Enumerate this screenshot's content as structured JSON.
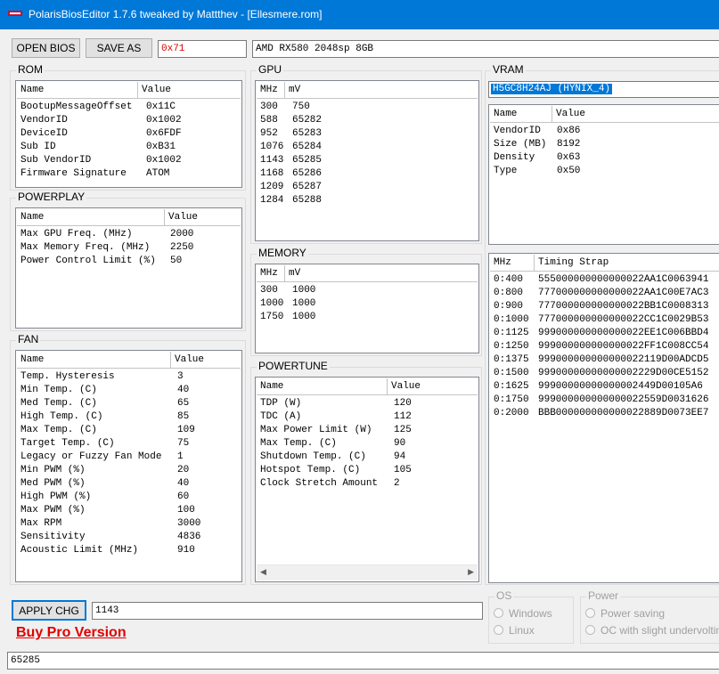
{
  "window": {
    "title": "PolarisBiosEditor 1.7.6 tweaked by Mattthev  - [Ellesmere.rom]",
    "titlebar_color": "#0078d7"
  },
  "toolbar": {
    "open_label": "OPEN BIOS",
    "save_label": "SAVE AS",
    "hex_value": "0x71",
    "gpu_name": "AMD RX580 2048sp 8GB"
  },
  "rom": {
    "label": "ROM",
    "col_name": "Name",
    "col_value": "Value",
    "rows": [
      {
        "name": "BootupMessageOffset",
        "value": "0x11C"
      },
      {
        "name": "VendorID",
        "value": "0x1002"
      },
      {
        "name": "DeviceID",
        "value": "0x6FDF"
      },
      {
        "name": "Sub ID",
        "value": "0xB31"
      },
      {
        "name": "Sub VendorID",
        "value": "0x1002"
      },
      {
        "name": "Firmware Signature",
        "value": "ATOM"
      }
    ]
  },
  "powerplay": {
    "label": "POWERPLAY",
    "col_name": "Name",
    "col_value": "Value",
    "rows": [
      {
        "name": "Max GPU Freq. (MHz)",
        "value": "2000"
      },
      {
        "name": "Max Memory Freq. (MHz)",
        "value": "2250"
      },
      {
        "name": "Power Control Limit (%)",
        "value": "50"
      }
    ]
  },
  "fan": {
    "label": "FAN",
    "col_name": "Name",
    "col_value": "Value",
    "rows": [
      {
        "name": "Temp. Hysteresis",
        "value": "3"
      },
      {
        "name": "Min Temp. (C)",
        "value": "40"
      },
      {
        "name": "Med Temp. (C)",
        "value": "65"
      },
      {
        "name": "High Temp. (C)",
        "value": "85"
      },
      {
        "name": "Max Temp. (C)",
        "value": "109"
      },
      {
        "name": "Target Temp. (C)",
        "value": "75"
      },
      {
        "name": "Legacy or Fuzzy Fan Mode",
        "value": "1"
      },
      {
        "name": "Min PWM (%)",
        "value": "20"
      },
      {
        "name": "Med PWM (%)",
        "value": "40"
      },
      {
        "name": "High PWM (%)",
        "value": "60"
      },
      {
        "name": "Max PWM (%)",
        "value": "100"
      },
      {
        "name": "Max RPM",
        "value": "3000"
      },
      {
        "name": "Sensitivity",
        "value": "4836"
      },
      {
        "name": "Acoustic Limit (MHz)",
        "value": "910"
      }
    ]
  },
  "gpu": {
    "label": "GPU",
    "col_mhz": "MHz",
    "col_mv": "mV",
    "rows": [
      {
        "mhz": "300",
        "mv": "750"
      },
      {
        "mhz": "588",
        "mv": "65282"
      },
      {
        "mhz": "952",
        "mv": "65283"
      },
      {
        "mhz": "1076",
        "mv": "65284"
      },
      {
        "mhz": "1143",
        "mv": "65285"
      },
      {
        "mhz": "1168",
        "mv": "65286"
      },
      {
        "mhz": "1209",
        "mv": "65287"
      },
      {
        "mhz": "1284",
        "mv": "65288"
      }
    ]
  },
  "memory": {
    "label": "MEMORY",
    "col_mhz": "MHz",
    "col_mv": "mV",
    "rows": [
      {
        "mhz": "300",
        "mv": "1000"
      },
      {
        "mhz": "1000",
        "mv": "1000"
      },
      {
        "mhz": "1750",
        "mv": "1000"
      }
    ]
  },
  "powertune": {
    "label": "POWERTUNE",
    "col_name": "Name",
    "col_value": "Value",
    "rows": [
      {
        "name": "TDP (W)",
        "value": "120"
      },
      {
        "name": "TDC (A)",
        "value": "112"
      },
      {
        "name": "Max Power Limit (W)",
        "value": "125"
      },
      {
        "name": "Max Temp. (C)",
        "value": "90"
      },
      {
        "name": "Shutdown Temp. (C)",
        "value": "94"
      },
      {
        "name": "Hotspot Temp. (C)",
        "value": "105"
      },
      {
        "name": "Clock Stretch Amount",
        "value": "2"
      }
    ]
  },
  "vram": {
    "label": "VRAM",
    "selected": "H5GC8H24AJ (HYNIX_4)",
    "col_name": "Name",
    "col_value": "Value",
    "rows": [
      {
        "name": "VendorID",
        "value": "0x86"
      },
      {
        "name": "Size (MB)",
        "value": "8192"
      },
      {
        "name": "Density",
        "value": "0x63"
      },
      {
        "name": "Type",
        "value": "0x50"
      }
    ]
  },
  "timings": {
    "col_mhz": "MHz",
    "col_strap": "Timing Strap",
    "rows": [
      {
        "mhz": "0:400",
        "strap": "555000000000000022AA1C0063941"
      },
      {
        "mhz": "0:800",
        "strap": "777000000000000022AA1C00E7AC3"
      },
      {
        "mhz": "0:900",
        "strap": "777000000000000022BB1C0008313"
      },
      {
        "mhz": "0:1000",
        "strap": "777000000000000022CC1C0029B53"
      },
      {
        "mhz": "0:1125",
        "strap": "999000000000000022EE1C006BBD4"
      },
      {
        "mhz": "0:1250",
        "strap": "999000000000000022FF1C008CC54"
      },
      {
        "mhz": "0:1375",
        "strap": "999000000000000022119D00ADCD5"
      },
      {
        "mhz": "0:1500",
        "strap": "99900000000000002229D00CE5152"
      },
      {
        "mhz": "0:1625",
        "strap": "99900000000000002449D00105A6"
      },
      {
        "mhz": "0:1750",
        "strap": "999000000000000022559D0031626"
      },
      {
        "mhz": "0:2000",
        "strap": "BBB000000000000022889D0073EE7"
      }
    ]
  },
  "apply": {
    "label": "APPLY CHG",
    "value": "1143"
  },
  "promo": {
    "label": "Buy Pro Version",
    "color": "#e00000"
  },
  "os_group": {
    "label": "OS",
    "options": [
      "Windows",
      "Linux"
    ]
  },
  "power_group": {
    "label": "Power",
    "options": [
      "Power saving",
      "OC with slight undervolting"
    ]
  },
  "status": {
    "value": "65285"
  }
}
